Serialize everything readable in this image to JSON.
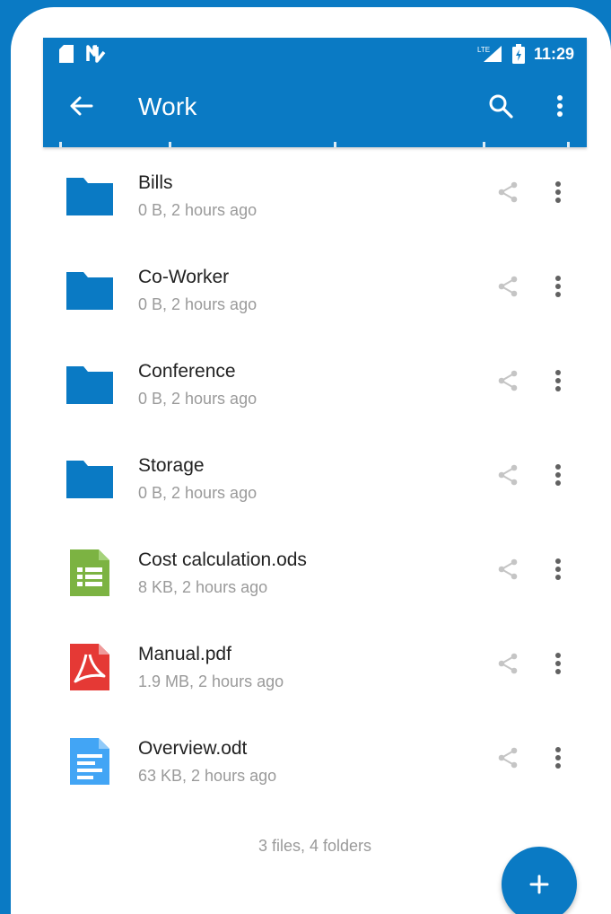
{
  "status_bar": {
    "time": "11:29",
    "signal_label": "LTE",
    "left_icons": [
      "sd-card-icon",
      "n-notification-icon"
    ],
    "right_icons": [
      "lte-signal-icon",
      "battery-icon"
    ]
  },
  "toolbar": {
    "title": "Work",
    "back_icon": "arrow-left-icon",
    "search_icon": "search-icon",
    "menu_icon": "more-vertical-icon"
  },
  "colors": {
    "brand": "#0a7ac4",
    "folder": "#0a7ac4",
    "spreadsheet": "#7cb342",
    "pdf": "#e53935",
    "document": "#42a5f5",
    "secondary_text": "#9a9a9a"
  },
  "files": [
    {
      "name": "Bills",
      "meta": "0 B, 2 hours ago",
      "type": "folder",
      "icon": "folder-icon"
    },
    {
      "name": "Co-Worker",
      "meta": "0 B, 2 hours ago",
      "type": "folder",
      "icon": "folder-icon"
    },
    {
      "name": "Conference",
      "meta": "0 B, 2 hours ago",
      "type": "folder",
      "icon": "folder-icon"
    },
    {
      "name": "Storage",
      "meta": "0 B, 2 hours ago",
      "type": "folder",
      "icon": "folder-icon"
    },
    {
      "name": "Cost calculation.ods",
      "meta": "8 KB, 2 hours ago",
      "type": "spreadsheet",
      "icon": "spreadsheet-icon"
    },
    {
      "name": "Manual.pdf",
      "meta": "1.9 MB, 2 hours ago",
      "type": "pdf",
      "icon": "pdf-icon"
    },
    {
      "name": "Overview.odt",
      "meta": "63 KB, 2 hours ago",
      "type": "document",
      "icon": "document-icon"
    }
  ],
  "summary": "3 files, 4 folders",
  "fab": {
    "icon": "plus-icon",
    "label": "+"
  }
}
